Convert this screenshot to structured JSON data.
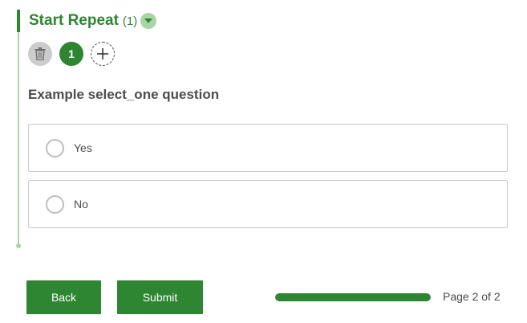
{
  "repeat": {
    "title": "Start Repeat",
    "count": "(1)",
    "current_record": "1",
    "toggle_icon": "caret-down-icon",
    "delete_icon": "trash-icon",
    "add_icon": "plus-icon"
  },
  "question": {
    "label": "Example select_one question",
    "choices": [
      {
        "label": "Yes",
        "selected": false
      },
      {
        "label": "No",
        "selected": false
      }
    ]
  },
  "footer": {
    "back_label": "Back",
    "submit_label": "Submit",
    "page_indicator": "Page 2 of 2",
    "progress_fraction": 1.0
  },
  "colors": {
    "accent": "#2e8532",
    "accent_light": "#a8d5a5",
    "text": "#4c4c4c",
    "border": "#cacaca"
  }
}
